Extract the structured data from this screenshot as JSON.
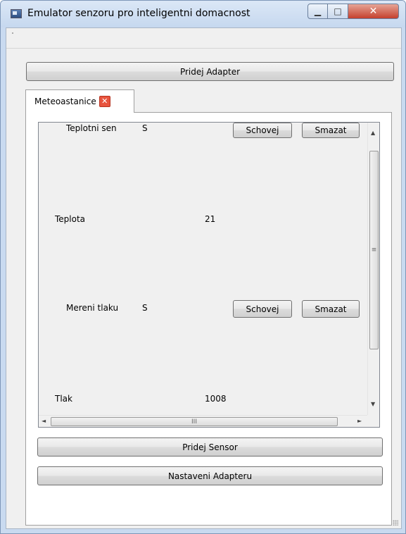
{
  "window": {
    "title": "Emulator senzoru pro inteligentni domacnost",
    "minimize_glyph": "▁",
    "maximize_glyph": "□",
    "close_glyph": "✕"
  },
  "toolbar": {
    "add_adapter_label": "Pridej Adapter"
  },
  "tabs": [
    {
      "label": "Meteoastanice",
      "close_glyph": "✕"
    }
  ],
  "sensors": [
    {
      "name": "Teplotni sen",
      "status": "S",
      "hide_label": "Schovej",
      "delete_label": "Smazat",
      "value_label": "Teplota",
      "value": "21"
    },
    {
      "name": "Mereni tlaku",
      "status": "S",
      "hide_label": "Schovej",
      "delete_label": "Smazat",
      "value_label": "Tlak",
      "value": "1008"
    }
  ],
  "scrollbar": {
    "up": "▲",
    "down": "▼",
    "left": "◄",
    "right": "►",
    "v_grip": "≡",
    "h_grip": "III"
  },
  "footer": {
    "add_sensor_label": "Pridej Sensor",
    "adapter_settings_label": "Nastaveni Adapteru"
  },
  "icons": {
    "app": "app-window-icon",
    "tab_close": "close-icon",
    "resize": "resize-grip-icon"
  }
}
